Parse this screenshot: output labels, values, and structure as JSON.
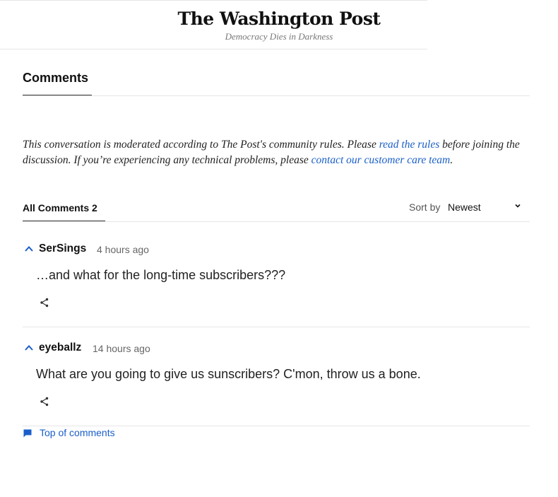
{
  "masthead": {
    "logo_text": "The Washington Post",
    "tagline": "Democracy Dies in Darkness"
  },
  "comments_section": {
    "title": "Comments",
    "notice": {
      "part1": "This conversation is moderated according to The Post's community rules. Please ",
      "rules_link": "read the rules",
      "part2": " before joining the discussion. If you’re experiencing any technical problems, please ",
      "care_link": "contact our customer care team",
      "part3": "."
    },
    "all_comments_label": "All Comments 2",
    "sort_label": "Sort by",
    "sort_value": "Newest"
  },
  "comments": [
    {
      "author": "SerSings",
      "time": "4 hours ago",
      "body": "…and what for the long-time subscribers???"
    },
    {
      "author": "eyeballz",
      "time": "14 hours ago",
      "body": "What are you going to give us sunscribers? C'mon, throw us a bone."
    }
  ],
  "footer": {
    "top_of_comments": "Top of comments"
  },
  "colors": {
    "link": "#1a5fc9",
    "rule": "#e6e6e6"
  }
}
